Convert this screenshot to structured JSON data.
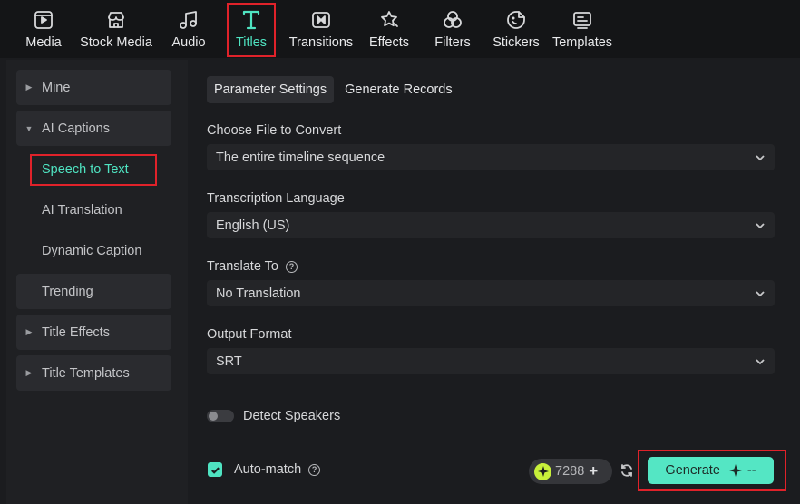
{
  "toolbar": {
    "items": [
      {
        "label": "Media",
        "icon": "media-icon"
      },
      {
        "label": "Stock Media",
        "icon": "stock-media-icon"
      },
      {
        "label": "Audio",
        "icon": "music-note-icon"
      },
      {
        "label": "Titles",
        "icon": "text-t-icon",
        "active": true
      },
      {
        "label": "Transitions",
        "icon": "transitions-icon"
      },
      {
        "label": "Effects",
        "icon": "effects-star-icon"
      },
      {
        "label": "Filters",
        "icon": "filters-icon"
      },
      {
        "label": "Stickers",
        "icon": "sticker-icon"
      },
      {
        "label": "Templates",
        "icon": "templates-icon"
      }
    ]
  },
  "sidebar": {
    "items": [
      {
        "label": "Mine",
        "expandable": true,
        "expanded": false
      },
      {
        "label": "AI Captions",
        "expandable": true,
        "expanded": true
      },
      {
        "label": "Speech to Text",
        "sub": true,
        "selected": true
      },
      {
        "label": "AI Translation",
        "sub": true
      },
      {
        "label": "Dynamic Caption",
        "sub": true
      },
      {
        "label": "Trending",
        "expandable": false
      },
      {
        "label": "Title Effects",
        "expandable": true,
        "expanded": false
      },
      {
        "label": "Title Templates",
        "expandable": true,
        "expanded": false
      }
    ]
  },
  "main": {
    "tabs": [
      {
        "label": "Parameter Settings",
        "active": true
      },
      {
        "label": "Generate Records",
        "active": false
      }
    ],
    "fields": {
      "file": {
        "label": "Choose File to Convert",
        "value": "The entire timeline sequence"
      },
      "language": {
        "label": "Transcription Language",
        "value": "English (US)"
      },
      "translate": {
        "label": "Translate To",
        "value": "No Translation"
      },
      "format": {
        "label": "Output Format",
        "value": "SRT"
      }
    },
    "detect_speakers": {
      "label": "Detect Speakers",
      "enabled": false
    },
    "auto_match": {
      "label": "Auto-match",
      "checked": true
    },
    "credits": {
      "value": "7288"
    },
    "generate": {
      "label": "Generate",
      "cost": "--"
    }
  },
  "colors": {
    "accent": "#4fe3c1",
    "highlight": "#e0222a",
    "credit_badge": "#c8f03a"
  }
}
